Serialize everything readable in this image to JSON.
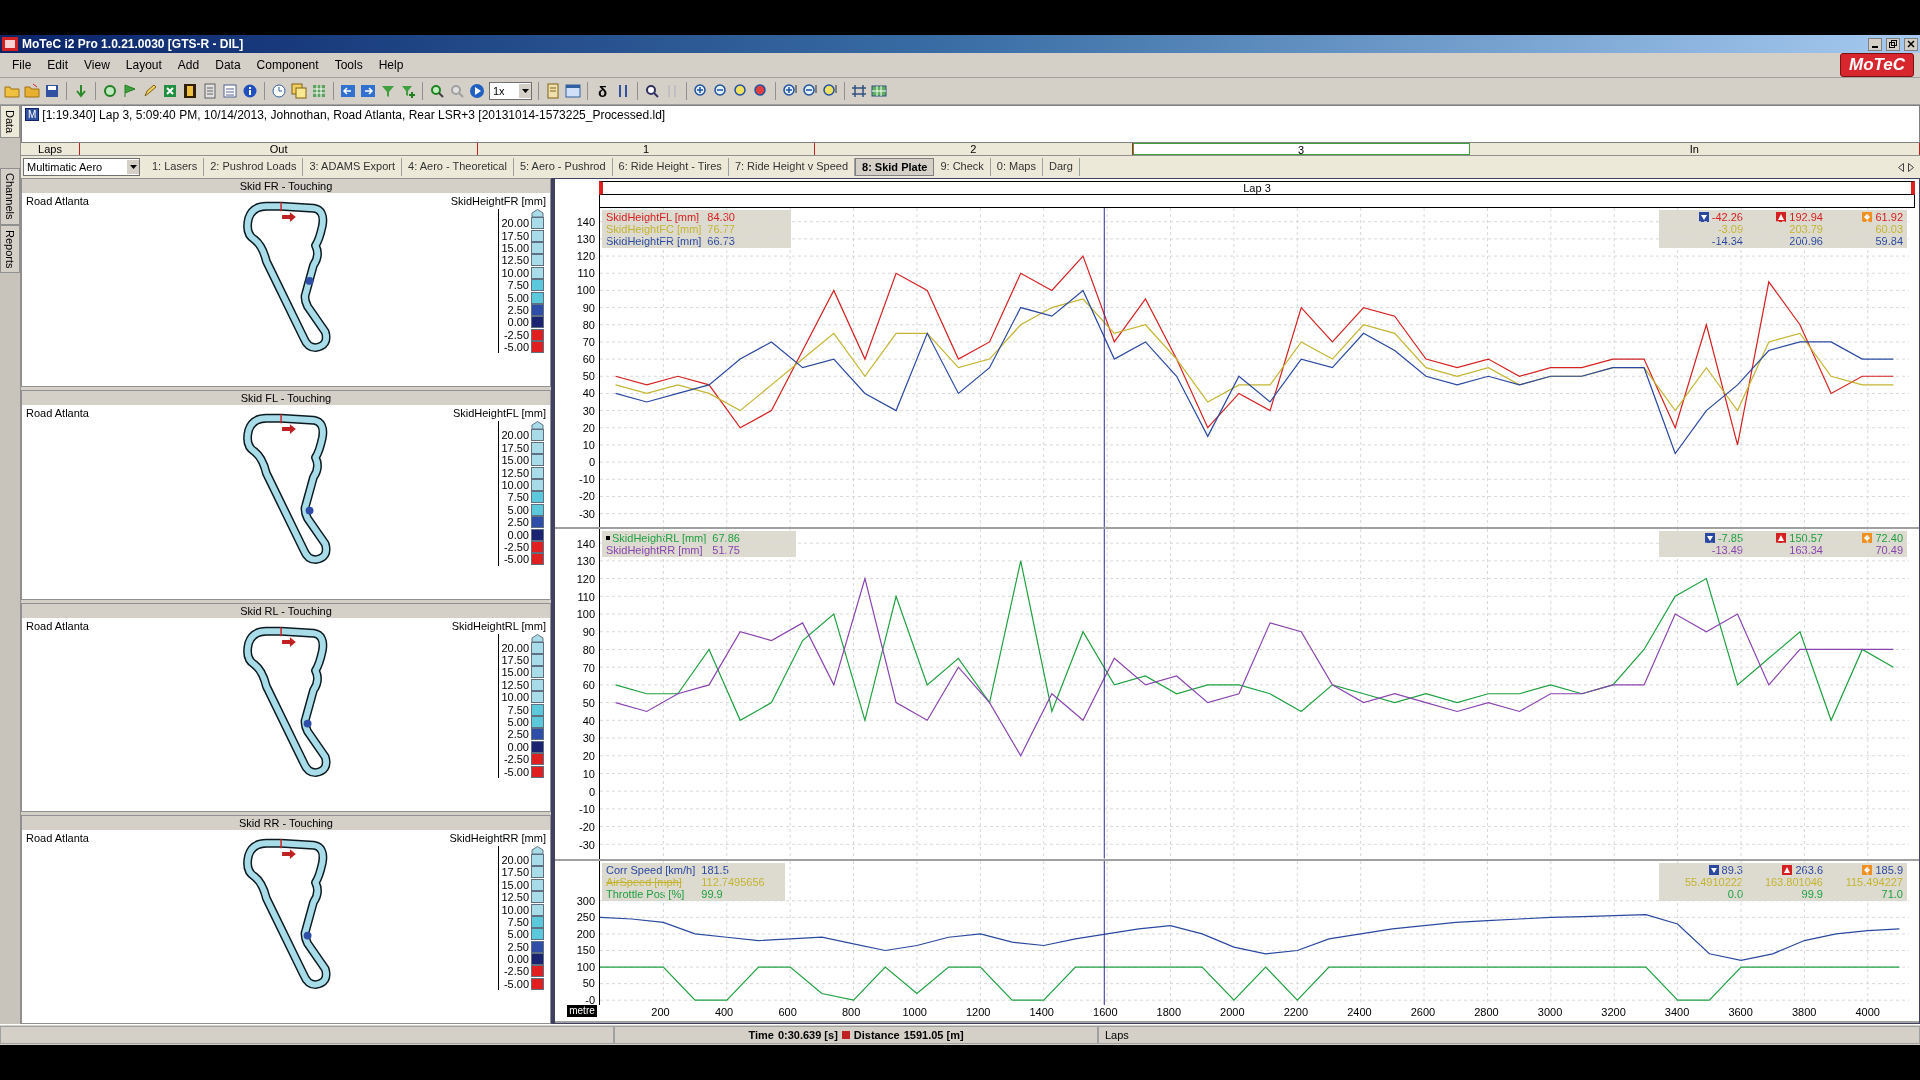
{
  "window": {
    "title": "MoTeC i2 Pro 1.0.21.0030  [GTS-R - DIL]"
  },
  "menu": [
    "File",
    "Edit",
    "View",
    "Layout",
    "Add",
    "Data",
    "Component",
    "Tools",
    "Help"
  ],
  "brand": "MoTeC",
  "toolbar": {
    "rate_select": "1x",
    "delta_symbol": "δ"
  },
  "side_tabs": [
    {
      "label": "Data",
      "selected": true
    },
    {
      "label": "Channels",
      "selected": false
    },
    {
      "label": "Reports",
      "selected": false
    }
  ],
  "data_line": {
    "badge": "M",
    "text": "[1:19.340] Lap 3, 5:09:40 PM, 10/14/2013, Johnothan, Road Atlanta, Rear LSR+3 [20131014-1573225_Processed.ld]"
  },
  "laps_bar": {
    "label": "Laps",
    "segments": [
      {
        "label": "Out",
        "selected": false
      },
      {
        "label": "1",
        "selected": false
      },
      {
        "label": "2",
        "selected": false
      },
      {
        "label": "3",
        "selected": true
      },
      {
        "label": "In",
        "selected": false
      }
    ]
  },
  "workbook_select": "Multimatic Aero",
  "tabs": [
    {
      "label": "1: Lasers",
      "selected": false
    },
    {
      "label": "2: Pushrod Loads",
      "selected": false
    },
    {
      "label": "3: ADAMS Export",
      "selected": false
    },
    {
      "label": "4: Aero - Theoretical",
      "selected": false
    },
    {
      "label": "5: Aero - Pushrod",
      "selected": false
    },
    {
      "label": "6: Ride Height - Tires",
      "selected": false
    },
    {
      "label": "7: Ride Height v Speed",
      "selected": false
    },
    {
      "label": "8: Skid Plate",
      "selected": true
    },
    {
      "label": "9: Check",
      "selected": false
    },
    {
      "label": "0: Maps",
      "selected": false
    },
    {
      "label": "Darg",
      "selected": false
    }
  ],
  "maps": [
    {
      "title": "Skid FR - Touching",
      "track": "Road Atlanta",
      "channel": "SkidHeightFR [mm]",
      "scale": [
        {
          "label": "20.00",
          "color": "#a8dce8"
        },
        {
          "label": "17.50",
          "color": "#a8dce8"
        },
        {
          "label": "15.00",
          "color": "#a8dce8"
        },
        {
          "label": "12.50",
          "color": "#a8dce8"
        },
        {
          "label": "10.00",
          "color": "#a8dce8"
        },
        {
          "label": "7.50",
          "color": "#5cc8dc"
        },
        {
          "label": "5.00",
          "color": "#5cc8dc"
        },
        {
          "label": "2.50",
          "color": "#2e4ea8"
        },
        {
          "label": "0.00",
          "color": "#1a2470"
        },
        {
          "label": "-2.50",
          "color": "#e02020"
        },
        {
          "label": "-5.00",
          "color": "#e02020"
        }
      ]
    },
    {
      "title": "Skid FL - Touching",
      "track": "Road Atlanta",
      "channel": "SkidHeightFL [mm]",
      "scale": [
        {
          "label": "20.00",
          "color": "#a8dce8"
        },
        {
          "label": "17.50",
          "color": "#a8dce8"
        },
        {
          "label": "15.00",
          "color": "#a8dce8"
        },
        {
          "label": "12.50",
          "color": "#a8dce8"
        },
        {
          "label": "10.00",
          "color": "#a8dce8"
        },
        {
          "label": "7.50",
          "color": "#5cc8dc"
        },
        {
          "label": "5.00",
          "color": "#5cc8dc"
        },
        {
          "label": "2.50",
          "color": "#2e4ea8"
        },
        {
          "label": "0.00",
          "color": "#1a2470"
        },
        {
          "label": "-2.50",
          "color": "#e02020"
        },
        {
          "label": "-5.00",
          "color": "#e02020"
        }
      ]
    },
    {
      "title": "Skid RL - Touching",
      "track": "Road Atlanta",
      "channel": "SkidHeightRL [mm]",
      "scale": [
        {
          "label": "20.00",
          "color": "#a8dce8"
        },
        {
          "label": "17.50",
          "color": "#a8dce8"
        },
        {
          "label": "15.00",
          "color": "#a8dce8"
        },
        {
          "label": "12.50",
          "color": "#a8dce8"
        },
        {
          "label": "10.00",
          "color": "#a8dce8"
        },
        {
          "label": "7.50",
          "color": "#5cc8dc"
        },
        {
          "label": "5.00",
          "color": "#5cc8dc"
        },
        {
          "label": "2.50",
          "color": "#2e4ea8"
        },
        {
          "label": "0.00",
          "color": "#1a2470"
        },
        {
          "label": "-2.50",
          "color": "#e02020"
        },
        {
          "label": "-5.00",
          "color": "#e02020"
        }
      ]
    },
    {
      "title": "Skid RR - Touching",
      "track": "Road Atlanta",
      "channel": "SkidHeightRR [mm]",
      "scale": [
        {
          "label": "20.00",
          "color": "#a8dce8"
        },
        {
          "label": "17.50",
          "color": "#a8dce8"
        },
        {
          "label": "15.00",
          "color": "#a8dce8"
        },
        {
          "label": "12.50",
          "color": "#a8dce8"
        },
        {
          "label": "10.00",
          "color": "#a8dce8"
        },
        {
          "label": "7.50",
          "color": "#5cc8dc"
        },
        {
          "label": "5.00",
          "color": "#5cc8dc"
        },
        {
          "label": "2.50",
          "color": "#2e4ea8"
        },
        {
          "label": "0.00",
          "color": "#1a2470"
        },
        {
          "label": "-2.50",
          "color": "#e02020"
        },
        {
          "label": "-5.00",
          "color": "#e02020"
        }
      ]
    }
  ],
  "graph": {
    "lap_label": "Lap 3",
    "panes": [
      {
        "chart_data": {
          "type": "line",
          "categories": [
            null,
            null,
            null,
            null,
            null,
            null,
            null,
            null,
            null,
            null,
            null,
            null,
            null,
            null,
            null,
            null,
            null,
            null,
            null,
            null,
            null,
            null,
            null,
            null,
            null,
            null,
            null,
            null,
            null,
            null,
            null,
            null,
            null,
            null,
            null,
            null,
            null,
            null,
            null,
            null,
            null,
            null
          ],
          "yticks": [
            140,
            130,
            120,
            110,
            100,
            90,
            80,
            70,
            60,
            50,
            40,
            30,
            20,
            10,
            0,
            -10,
            -20,
            -30
          ],
          "ylim": [
            -38,
            148
          ],
          "grid": true,
          "series": [
            {
              "color": "#d42020",
              "values": [
                50,
                45,
                50,
                45,
                20,
                30,
                65,
                100,
                60,
                110,
                100,
                60,
                70,
                110,
                100,
                120,
                70,
                95,
                60,
                20,
                40,
                30,
                90,
                70,
                90,
                85,
                60,
                55,
                60,
                50,
                55,
                55,
                60,
                60,
                20,
                80,
                10,
                105,
                80,
                40,
                50,
                50
              ]
            },
            {
              "color": "#c4b430",
              "values": [
                45,
                40,
                45,
                40,
                30,
                45,
                60,
                75,
                50,
                75,
                75,
                55,
                60,
                80,
                90,
                95,
                75,
                80,
                60,
                35,
                45,
                45,
                70,
                60,
                80,
                75,
                55,
                50,
                55,
                45,
                50,
                50,
                55,
                55,
                30,
                55,
                30,
                70,
                75,
                50,
                45,
                45
              ]
            },
            {
              "color": "#2a48a0",
              "values": [
                40,
                35,
                40,
                45,
                60,
                70,
                55,
                60,
                40,
                30,
                75,
                40,
                55,
                90,
                85,
                100,
                60,
                70,
                50,
                15,
                50,
                35,
                60,
                55,
                75,
                65,
                50,
                45,
                50,
                45,
                50,
                50,
                55,
                55,
                5,
                30,
                45,
                65,
                70,
                70,
                60,
                60
              ]
            }
          ]
        },
        "channels": [
          {
            "name": "SkidHeightFL [mm]",
            "value": "84.30",
            "min": "-42.26",
            "max": "192.94",
            "avg": "61.92",
            "color": "#d42020",
            "hidden": false,
            "selected": false
          },
          {
            "name": "SkidHeightFC [mm]",
            "value": "76.77",
            "min": "-3.09",
            "max": "203.79",
            "avg": "60.03",
            "color": "#c4b430",
            "hidden": false,
            "selected": false
          },
          {
            "name": "SkidHeightFR [mm]",
            "value": "66.73",
            "min": "-14.34",
            "max": "200.96",
            "avg": "59.84",
            "color": "#2a48a0",
            "hidden": false,
            "selected": false
          }
        ]
      },
      {
        "chart_data": {
          "type": "line",
          "categories": [
            null,
            null,
            null,
            null,
            null,
            null,
            null,
            null,
            null,
            null,
            null,
            null,
            null,
            null,
            null,
            null,
            null,
            null,
            null,
            null,
            null,
            null,
            null,
            null,
            null,
            null,
            null,
            null,
            null,
            null,
            null,
            null,
            null,
            null,
            null,
            null,
            null,
            null,
            null,
            null,
            null,
            null
          ],
          "yticks": [
            140,
            130,
            120,
            110,
            100,
            90,
            80,
            70,
            60,
            50,
            40,
            30,
            20,
            10,
            0,
            -10,
            -20,
            -30
          ],
          "ylim": [
            -38,
            148
          ],
          "grid": true,
          "series": [
            {
              "color": "#1fa040",
              "values": [
                60,
                55,
                55,
                80,
                40,
                50,
                85,
                100,
                40,
                110,
                60,
                75,
                50,
                130,
                45,
                90,
                60,
                65,
                55,
                60,
                60,
                55,
                45,
                60,
                55,
                50,
                55,
                50,
                55,
                55,
                60,
                55,
                60,
                80,
                110,
                120,
                60,
                75,
                90,
                40,
                80,
                70
              ]
            },
            {
              "color": "#8a44b0",
              "values": [
                50,
                45,
                55,
                60,
                90,
                85,
                95,
                60,
                120,
                50,
                40,
                70,
                50,
                20,
                55,
                40,
                75,
                60,
                65,
                50,
                55,
                95,
                90,
                60,
                50,
                55,
                50,
                45,
                50,
                45,
                55,
                55,
                60,
                60,
                100,
                90,
                100,
                60,
                80,
                80,
                80,
                80
              ]
            }
          ]
        },
        "channels": [
          {
            "name": "SkidHeightRL [mm]",
            "value": "67.86",
            "min": "-7.85",
            "max": "150.57",
            "avg": "72.40",
            "color": "#1fa040",
            "hidden": false,
            "selected": true
          },
          {
            "name": "SkidHeightRR [mm]",
            "value": "51.75",
            "min": "-13.49",
            "max": "163.34",
            "avg": "70.49",
            "color": "#8a44b0",
            "hidden": false,
            "selected": false
          }
        ]
      },
      {
        "chart_data": {
          "type": "line",
          "xlabel": "metre",
          "x": [
            0,
            100,
            200,
            300,
            400,
            500,
            600,
            700,
            800,
            900,
            1000,
            1100,
            1200,
            1300,
            1400,
            1500,
            1600,
            1700,
            1800,
            1900,
            2000,
            2100,
            2200,
            2300,
            2400,
            2500,
            2600,
            2700,
            2800,
            2900,
            3000,
            3100,
            3200,
            3300,
            3400,
            3500,
            3600,
            3700,
            3800,
            3900,
            4000,
            4100
          ],
          "xlim": [
            0,
            4130
          ],
          "xticks": [
            200,
            400,
            600,
            800,
            1000,
            1200,
            1400,
            1600,
            1800,
            2000,
            2200,
            2400,
            2600,
            2800,
            3000,
            3200,
            3400,
            3600,
            3800,
            4000
          ],
          "yticks": [
            300,
            250,
            200,
            150,
            100,
            50,
            {
              "value": 0,
              "label": "-0"
            }
          ],
          "ylim": [
            -15,
            420
          ],
          "grid": true,
          "ref_lines": [
            {
              "axis": "x",
              "value": 1591
            }
          ],
          "series": [
            {
              "color": "#2a48a0",
              "values": [
                250,
                245,
                235,
                200,
                190,
                180,
                185,
                190,
                170,
                150,
                165,
                190,
                200,
                175,
                165,
                185,
                200,
                215,
                225,
                200,
                160,
                140,
                150,
                185,
                200,
                215,
                225,
                235,
                240,
                245,
                250,
                252,
                255,
                258,
                230,
                140,
                120,
                140,
                180,
                200,
                210,
                215
              ]
            },
            {
              "color": "#1fa040",
              "values": [
                100,
                100,
                100,
                0,
                0,
                100,
                100,
                20,
                0,
                100,
                20,
                100,
                100,
                0,
                0,
                100,
                100,
                100,
                100,
                100,
                0,
                100,
                0,
                100,
                100,
                100,
                100,
                100,
                100,
                100,
                100,
                100,
                100,
                100,
                0,
                0,
                100,
                100,
                100,
                100,
                100,
                100
              ]
            }
          ]
        },
        "channels": [
          {
            "name": "Corr Speed [km/h]",
            "value": "181.5",
            "min": "89.3",
            "max": "263.6",
            "avg": "185.9",
            "color": "#2a48a0",
            "hidden": false,
            "selected": false
          },
          {
            "name": "AirSpeed [mph]",
            "value": "112.7495656",
            "min": "55.4910222",
            "max": "163.801046",
            "avg": "115.494227",
            "color": "#c4b430",
            "hidden": true,
            "selected": false
          },
          {
            "name": "Throttle Pos [%]",
            "value": "99.9",
            "min": "0.0",
            "max": "99.9",
            "avg": "71.0",
            "color": "#1fa040",
            "hidden": false,
            "selected": false
          }
        ]
      }
    ]
  },
  "status_bar": {
    "time_label": "Time",
    "time": "0:30.639 [s]",
    "distance_label": "Distance",
    "distance": "1591.05 [m]",
    "laps": "Laps"
  }
}
